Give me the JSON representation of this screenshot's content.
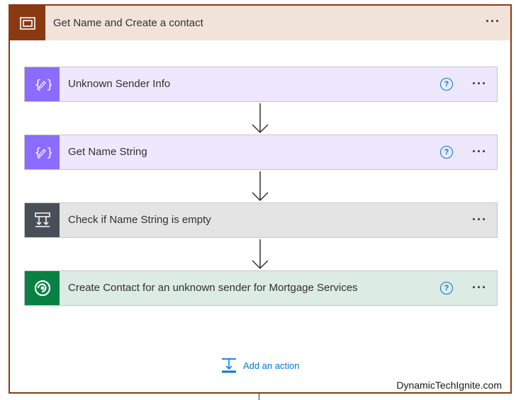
{
  "scope": {
    "title": "Get Name and Create a contact",
    "menu": "···",
    "color": "#8a3a12",
    "header_bg": "#f2e3da"
  },
  "steps": [
    {
      "title": "Unknown Sender Info",
      "icon": "variable-icon",
      "help": "?",
      "menu": "···",
      "accent": "#8c6cff",
      "bg": "#ede8fd"
    },
    {
      "title": "Get Name String",
      "icon": "variable-icon",
      "help": "?",
      "menu": "···",
      "accent": "#8c6cff",
      "bg": "#ede8fd"
    },
    {
      "title": "Check if Name String is empty",
      "icon": "condition-icon",
      "menu": "···",
      "accent": "#484f58",
      "bg": "#e4e4e4"
    },
    {
      "title": "Create Contact for an unknown sender for Mortgage Services",
      "icon": "dataverse-icon",
      "help": "?",
      "menu": "···",
      "accent": "#088142",
      "bg": "#dcebe3"
    }
  ],
  "add_action": {
    "label": "Add an action",
    "icon": "add-action-icon"
  },
  "watermark": "DynamicTechIgnite.com"
}
